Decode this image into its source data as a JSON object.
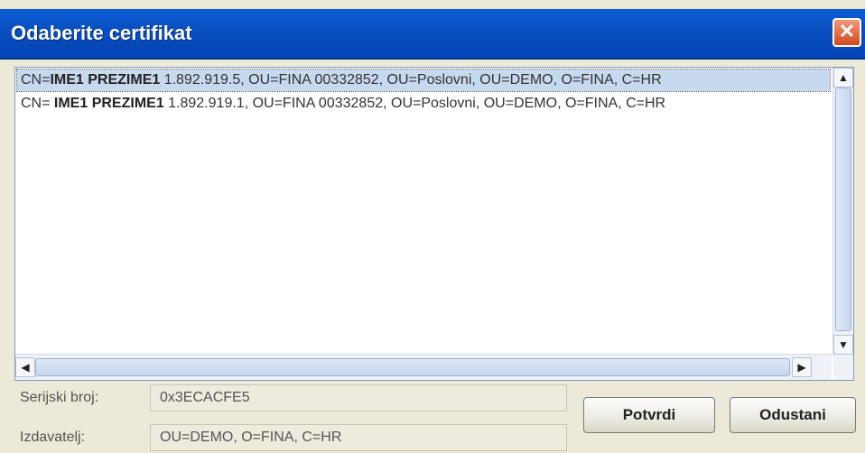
{
  "dialog": {
    "title": "Odaberite certifikat",
    "close_symbol": "✕"
  },
  "list": {
    "rows": [
      {
        "prefix": "CN=",
        "name": "IME1 PREZIME1",
        "rest": " 1.892.919.5, OU=FINA 00332852, OU=Poslovni, OU=DEMO, O=FINA, C=HR"
      },
      {
        "prefix": "CN= ",
        "name": "IME1 PREZIME1",
        "rest": " 1.892.919.1, OU=FINA 00332852, OU=Poslovni, OU=DEMO, O=FINA, C=HR"
      }
    ]
  },
  "details": {
    "serial_label": "Serijski broj:",
    "serial_value": "0x3ECACFE5",
    "issuer_label": "Izdavatelj:",
    "issuer_value": "OU=DEMO, O=FINA, C=HR"
  },
  "buttons": {
    "confirm": "Potvrdi",
    "cancel": "Odustani"
  },
  "icons": {
    "scroll_up": "▲",
    "scroll_down": "▼",
    "scroll_left": "◀",
    "scroll_right": "▶"
  }
}
